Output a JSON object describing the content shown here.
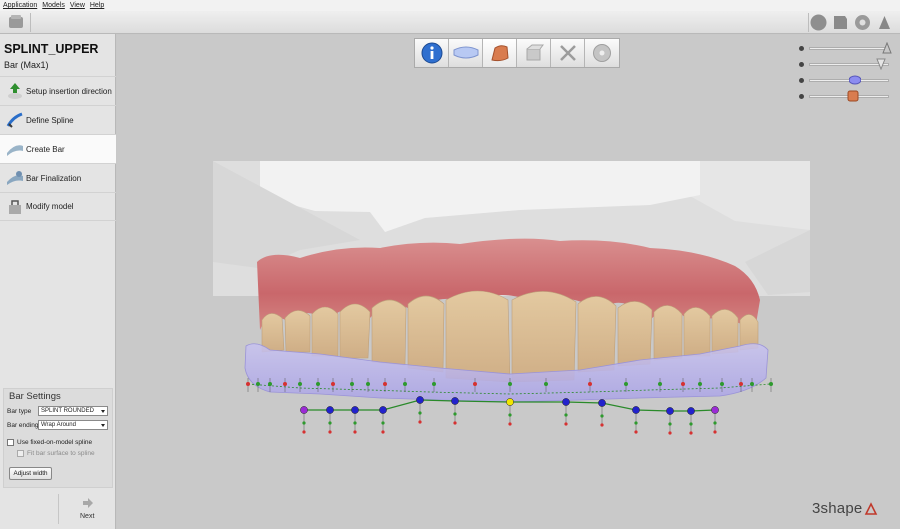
{
  "menu": [
    "Application",
    "Models",
    "View",
    "Help"
  ],
  "project": {
    "title": "SPLINT_UPPER",
    "subtitle": "Bar (Max1)"
  },
  "steps": [
    {
      "label": "Setup insertion direction",
      "icon": "insertion-arrow-icon",
      "active": false
    },
    {
      "label": "Define Spline",
      "icon": "spline-pen-icon",
      "active": false
    },
    {
      "label": "Create Bar",
      "icon": "bar-shape-icon",
      "active": true
    },
    {
      "label": "Bar Finalization",
      "icon": "finalize-bar-icon",
      "active": false
    },
    {
      "label": "Modify model",
      "icon": "modify-model-icon",
      "active": false
    }
  ],
  "bar_settings": {
    "header": "Bar Settings",
    "bar_type_label": "Bar type",
    "bar_type_value": "SPLINT ROUNDED",
    "bar_ending_label": "Bar ending",
    "bar_ending_value": "Wrap Around",
    "use_fixed_label": "Use fixed-on-model spline",
    "use_fixed_checked": false,
    "fit_surface_label": "Fit bar surface to spline",
    "fit_surface_checked": false,
    "adjust_width_label": "Adjust width"
  },
  "nav": {
    "next_label": "Next"
  },
  "workflow_tabs": [
    "info-icon",
    "splint-icon",
    "bar-icon",
    "model-icon",
    "tools-icon",
    "disc-icon"
  ],
  "visibility_sliders": [
    {
      "name": "upper-model",
      "level": 1.0,
      "color": "#c8c8c8"
    },
    {
      "name": "antagonist",
      "level": 0.92,
      "color": "#e0e0e0"
    },
    {
      "name": "splint",
      "level": 0.6,
      "color": "#8c8cf0"
    },
    {
      "name": "bar",
      "level": 0.58,
      "color": "#d97c4f"
    }
  ],
  "brand": {
    "name": "3shape"
  },
  "colors": {
    "accent": "#2f6fcf",
    "bar_color": "#d97c4f",
    "control_point": "#2222cc",
    "selected_point": "#f2e600",
    "end_point": "#9b2bd6",
    "spline": "#2a8a2a"
  }
}
